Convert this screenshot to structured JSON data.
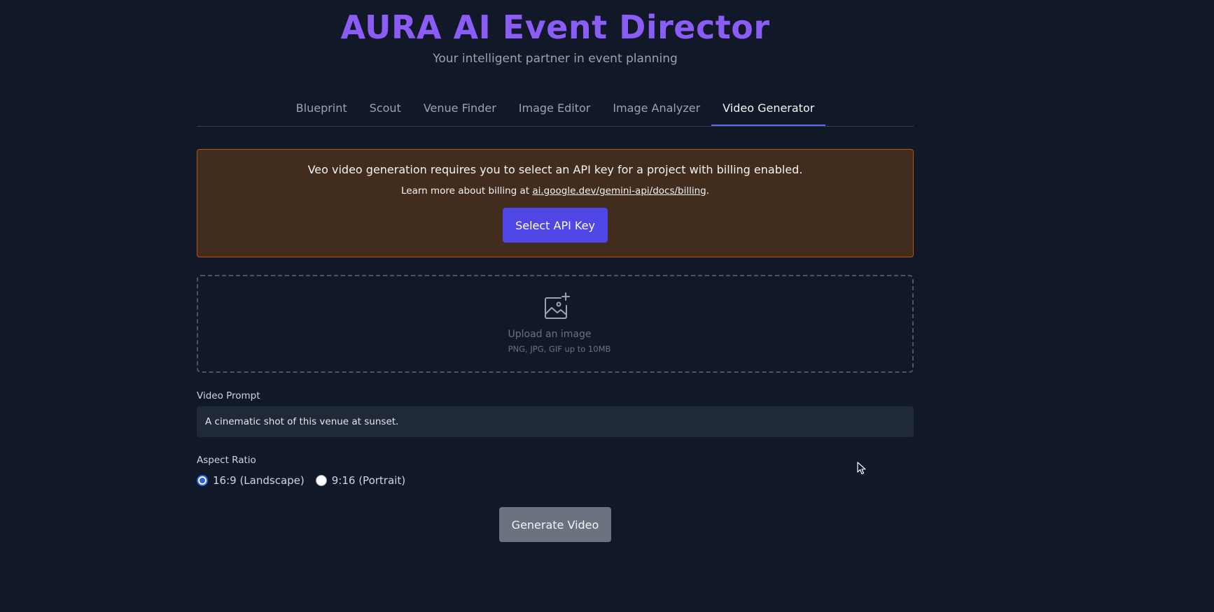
{
  "header": {
    "title": "AURA AI Event Director",
    "subtitle": "Your intelligent partner in event planning"
  },
  "tabs": [
    {
      "label": "Blueprint",
      "active": false
    },
    {
      "label": "Scout",
      "active": false
    },
    {
      "label": "Venue Finder",
      "active": false
    },
    {
      "label": "Image Editor",
      "active": false
    },
    {
      "label": "Image Analyzer",
      "active": false
    },
    {
      "label": "Video Generator",
      "active": true
    }
  ],
  "notice": {
    "message": "Veo video generation requires you to select an API key for a project with billing enabled.",
    "billing_prefix": "Learn more about billing at ",
    "billing_link": "ai.google.dev/gemini-api/docs/billing",
    "billing_suffix": ".",
    "button_label": "Select API Key"
  },
  "upload": {
    "label": "Upload an image",
    "hint": "PNG, JPG, GIF up to 10MB",
    "icon": "image-plus-icon"
  },
  "prompt": {
    "label": "Video Prompt",
    "value": "A cinematic shot of this venue at sunset."
  },
  "aspect_ratio": {
    "label": "Aspect Ratio",
    "options": [
      {
        "label": "16:9 (Landscape)",
        "selected": true
      },
      {
        "label": "9:16 (Portrait)",
        "selected": false
      }
    ]
  },
  "generate_button": "Generate Video",
  "colors": {
    "background": "#111827",
    "title": "#8b5cf6",
    "accent": "#4f46e5",
    "tab_underline": "#6366f1",
    "notice_bg": "#422c1e",
    "notice_border": "#b45309",
    "disabled_button": "#6b7280"
  }
}
